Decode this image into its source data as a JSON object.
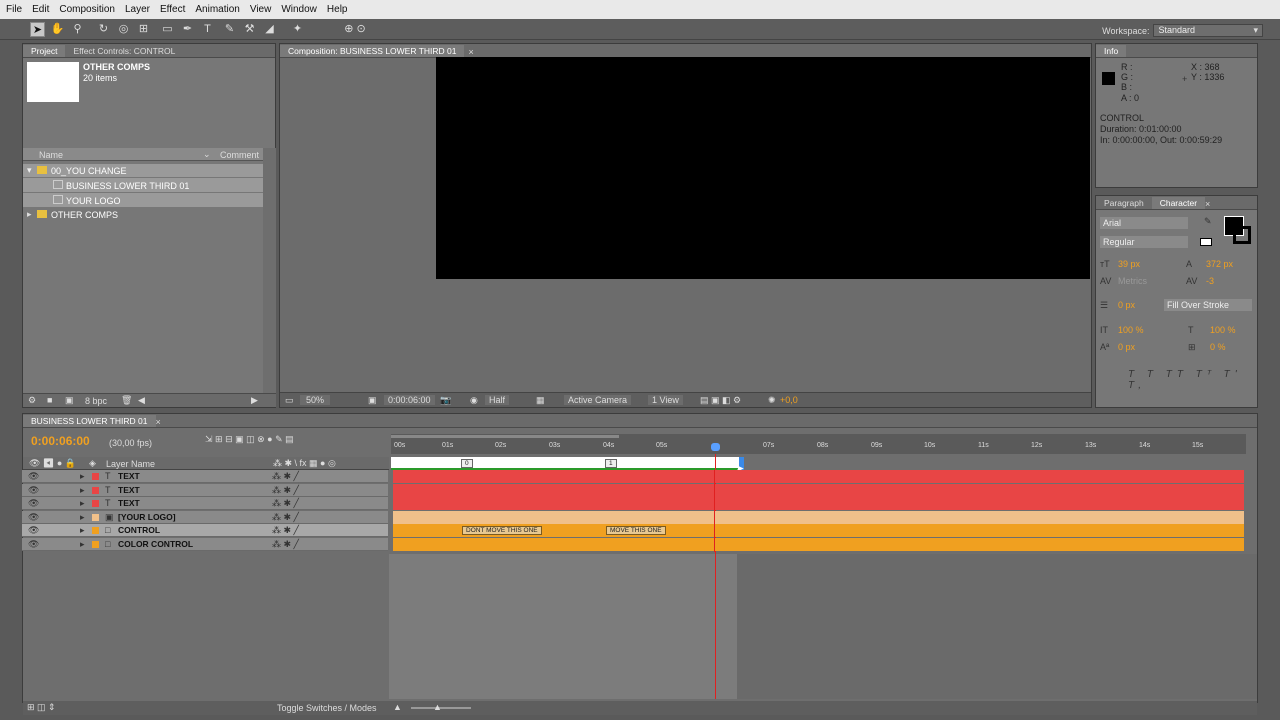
{
  "menu": [
    "File",
    "Edit",
    "Composition",
    "Layer",
    "Effect",
    "Animation",
    "View",
    "Window",
    "Help"
  ],
  "workspace": {
    "label": "Workspace:",
    "value": "Standard"
  },
  "project": {
    "tabs": [
      "Project",
      "Effect Controls: CONTROL"
    ],
    "thumb_title": "OTHER COMPS",
    "thumb_sub": "20 items",
    "col_name": "Name",
    "col_comment": "Comment",
    "items": [
      "00_YOU CHANGE",
      "BUSINESS LOWER THIRD 01",
      "YOUR LOGO",
      "OTHER COMPS"
    ],
    "bpc": "8 bpc"
  },
  "composition": {
    "tab": "Composition: BUSINESS LOWER THIRD 01",
    "zoom": "50%",
    "time": "0:00:06:00",
    "resolution": "Half",
    "camera": "Active Camera",
    "view": "1 View",
    "exposure": "+0,0"
  },
  "info": {
    "tab": "Info",
    "r": "R :",
    "g": "G :",
    "b": "B :",
    "a": "A : 0",
    "x": "X : 368",
    "y": "Y : 1336",
    "layer": "CONTROL",
    "duration": "Duration: 0:01:00:00",
    "inout": "In: 0:00:00:00, Out: 0:00:59:29"
  },
  "character": {
    "tabs": [
      "Paragraph",
      "Character"
    ],
    "font": "Arial",
    "style": "Regular",
    "size": "39 px",
    "leading": "372 px",
    "kerning": "Metrics",
    "tracking": "-3",
    "stroke": "0 px",
    "stroke_mode": "Fill Over Stroke",
    "vscale": "100 %",
    "hscale": "100 %",
    "baseline": "0 px",
    "tsume": "0 %"
  },
  "timeline": {
    "tab": "BUSINESS LOWER THIRD 01",
    "time": "0:00:06:00",
    "fps": "(30,00 fps)",
    "col_layer": "Layer Name",
    "ruler": [
      "00s",
      "01s",
      "02s",
      "03s",
      "04s",
      "05s",
      "07s",
      "08s",
      "09s",
      "10s",
      "11s",
      "12s",
      "13s",
      "14s",
      "15s"
    ],
    "layers": [
      {
        "name": "TEXT",
        "type": "T"
      },
      {
        "name": "TEXT",
        "type": "T"
      },
      {
        "name": "TEXT",
        "type": "T"
      },
      {
        "name": "[YOUR LOGO]",
        "type": "comp"
      },
      {
        "name": "CONTROL",
        "type": "solid"
      },
      {
        "name": "COLOR CONTROL",
        "type": "solid"
      }
    ],
    "markers": [
      "DONT MOVE THIS ONE",
      "MOVE THIS ONE"
    ],
    "comp_markers": [
      "0",
      "1"
    ],
    "toggle": "Toggle Switches / Modes"
  },
  "colors": {
    "text_bar": "#e84545",
    "logo_bar": "#f0c08a",
    "ctrl_bar": "#f0a020",
    "accent": "#f0a020"
  }
}
